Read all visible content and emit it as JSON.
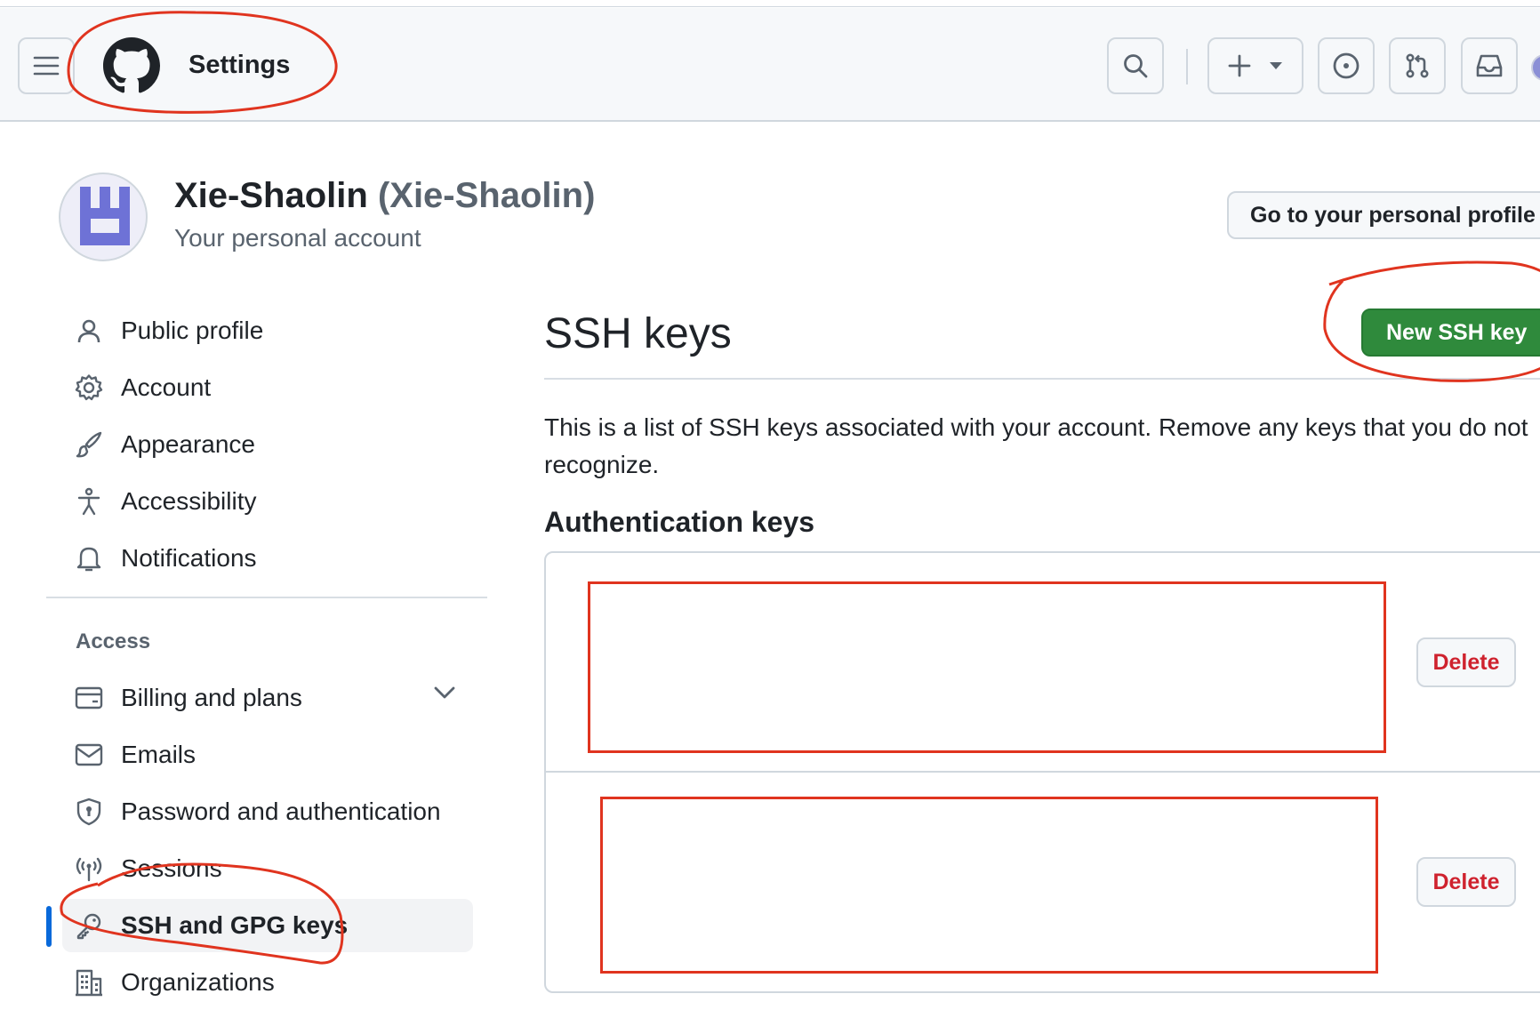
{
  "header": {
    "title": "Settings",
    "icons": [
      "hamburger-menu-icon",
      "github-logo-icon",
      "search-icon",
      "plus-icon",
      "triangle-down-icon",
      "issue-opened-icon",
      "git-pull-request-icon",
      "inbox-icon"
    ]
  },
  "profile": {
    "name": "Xie-Shaolin",
    "login": "(Xie-Shaolin)",
    "subtitle": "Your personal account",
    "profile_button": "Go to your personal profile"
  },
  "sidebar": {
    "items": [
      {
        "label": "Public profile",
        "icon": "person-icon"
      },
      {
        "label": "Account",
        "icon": "gear-icon"
      },
      {
        "label": "Appearance",
        "icon": "paintbrush-icon"
      },
      {
        "label": "Accessibility",
        "icon": "accessibility-icon"
      },
      {
        "label": "Notifications",
        "icon": "bell-icon"
      }
    ],
    "access_heading": "Access",
    "access_items": [
      {
        "label": "Billing and plans",
        "icon": "credit-card-icon"
      },
      {
        "label": "Emails",
        "icon": "mail-icon"
      },
      {
        "label": "Password and authentication",
        "icon": "shield-lock-icon"
      },
      {
        "label": "Sessions",
        "icon": "broadcast-icon"
      },
      {
        "label": "SSH and GPG keys",
        "icon": "key-icon",
        "active": true
      },
      {
        "label": "Organizations",
        "icon": "organization-icon"
      }
    ]
  },
  "main": {
    "title": "SSH keys",
    "new_button": "New SSH key",
    "description": "This is a list of SSH keys associated with your account. Remove any keys that you do not recognize.",
    "section_title": "Authentication keys",
    "keys": [
      {
        "delete_label": "Delete"
      },
      {
        "delete_label": "Delete"
      }
    ]
  },
  "colors": {
    "accent_blue": "#0969da",
    "primary_green": "#2f8a3c",
    "danger_red": "#cf222e",
    "annotation_red": "#e0341f"
  }
}
